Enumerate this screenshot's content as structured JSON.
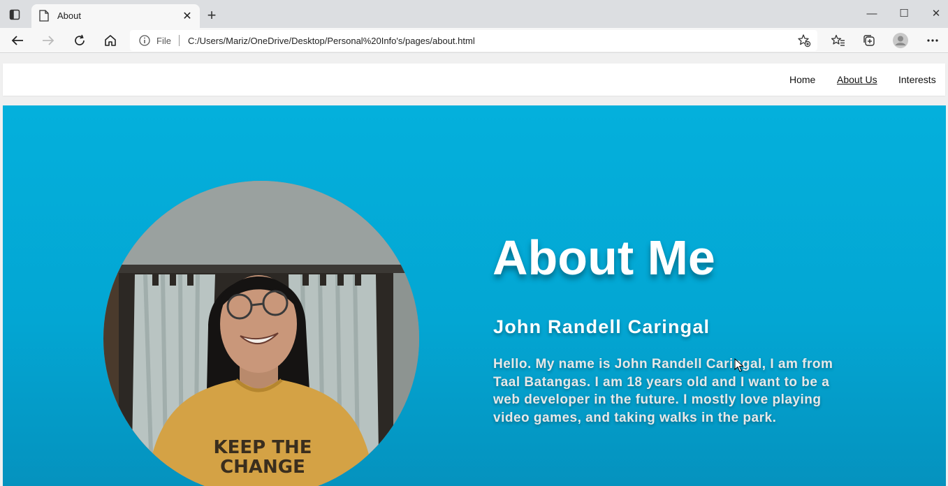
{
  "browser": {
    "tab_title": "About",
    "tab_close": "✕",
    "new_tab": "+",
    "address_scheme": "File",
    "address_url": "C:/Users/Mariz/OneDrive/Desktop/Personal%20Info's/pages/about.html",
    "window_controls": [
      "—",
      "☐",
      "✕"
    ],
    "icons": [
      "tab-sidebar-icon",
      "page-icon",
      "back-arrow-icon",
      "forward-arrow-icon",
      "reload-icon",
      "home-icon",
      "info-icon",
      "add-favorite-icon",
      "favorites-icon",
      "collections-icon",
      "profile-icon",
      "more-options-icon"
    ]
  },
  "site": {
    "nav": [
      {
        "label": "Home",
        "active": false
      },
      {
        "label": "About Us",
        "active": true
      },
      {
        "label": "Interests",
        "active": false
      }
    ],
    "hero": {
      "title": "About Me",
      "name": "John Randell Caringal",
      "bio": "Hello. My name is John Randell Caringal, I am from Taal Batangas. I am 18 years old and I want to be a web developer in the future. I mostly love playing video games, and taking walks in the park.",
      "photo_shirt_text": "KEEP THE CHANGE"
    },
    "colors": {
      "hero_top": "#04b0dc",
      "hero_bottom": "#0591bd",
      "text": "#ffffff"
    }
  }
}
